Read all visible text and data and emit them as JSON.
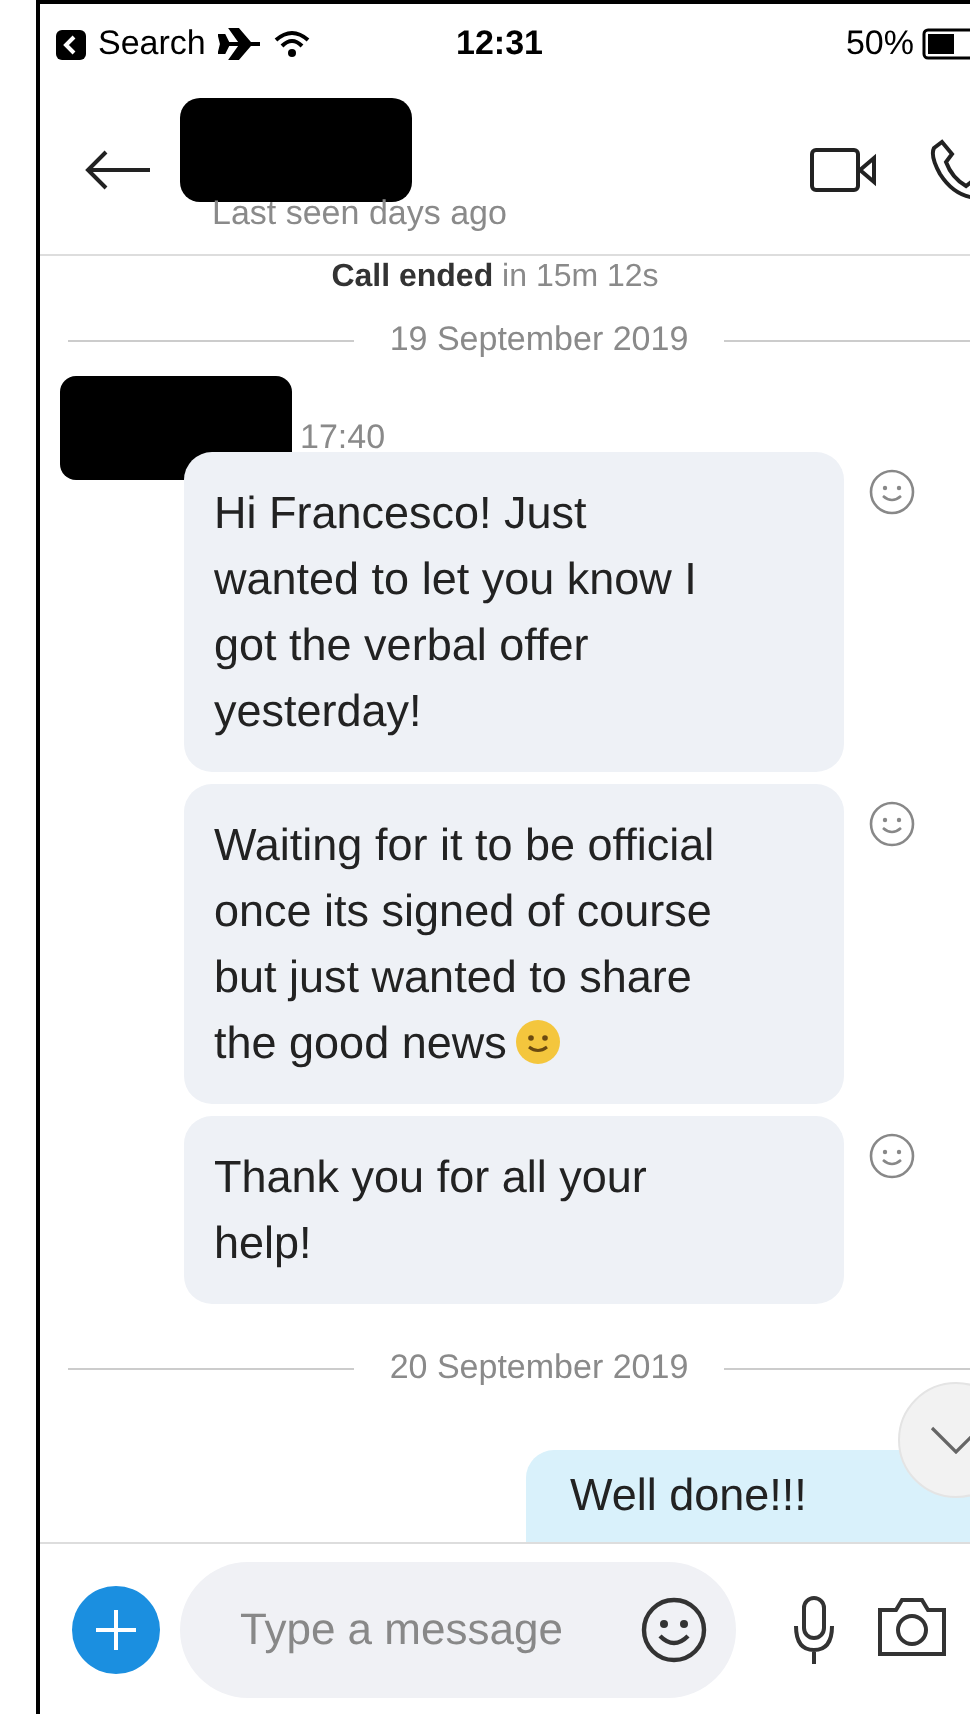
{
  "status_bar": {
    "back_label": "Search",
    "time": "12:31",
    "battery": "50%"
  },
  "header": {
    "subtitle": "Last seen days ago"
  },
  "call_notice": {
    "bold": "Call ended",
    "rest": "in 15m 12s"
  },
  "sections": [
    {
      "date": "19 September 2019",
      "sender_time": "17:40",
      "messages": [
        {
          "text": "Hi Francesco! Just wanted to let you know I got the verbal offer yesterday!",
          "has_emoji": false
        },
        {
          "text": "Waiting for it to be official once its signed of course but just wanted to share the good news",
          "has_emoji": true
        },
        {
          "text": "Thank you for all your help!",
          "has_emoji": false
        }
      ]
    },
    {
      "date": "20 September 2019",
      "outgoing": [
        {
          "text": "Well done!!!"
        }
      ]
    }
  ],
  "composer": {
    "placeholder": "Type a message"
  }
}
